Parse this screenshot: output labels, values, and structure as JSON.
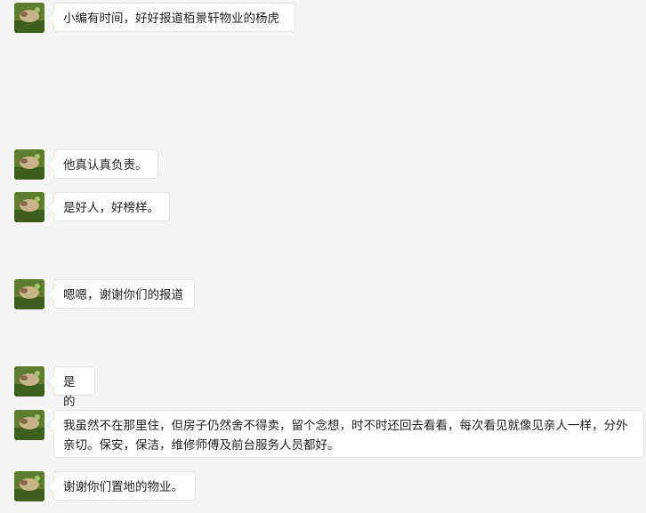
{
  "messages": [
    {
      "avatar_icon": "user-avatar-icon",
      "text": "小编有时间，好好报道栢景轩物业的杨虎"
    },
    {
      "avatar_icon": "user-avatar-icon",
      "text": "他真认真负责。"
    },
    {
      "avatar_icon": "user-avatar-icon",
      "text": "是好人，好榜样。"
    },
    {
      "avatar_icon": "user-avatar-icon",
      "text": "嗯嗯，谢谢你们的报道"
    },
    {
      "avatar_icon": "user-avatar-icon",
      "text": "是的"
    },
    {
      "avatar_icon": "user-avatar-icon",
      "text": "我虽然不在那里住，但房子仍然舍不得卖，留个念想，时不时还回去看看，每次看见就像见亲人一样，分外亲切。保安，保洁，维修师傅及前台服务人员都好。"
    },
    {
      "avatar_icon": "user-avatar-icon",
      "text": "谢谢你们置地的物业。"
    }
  ]
}
